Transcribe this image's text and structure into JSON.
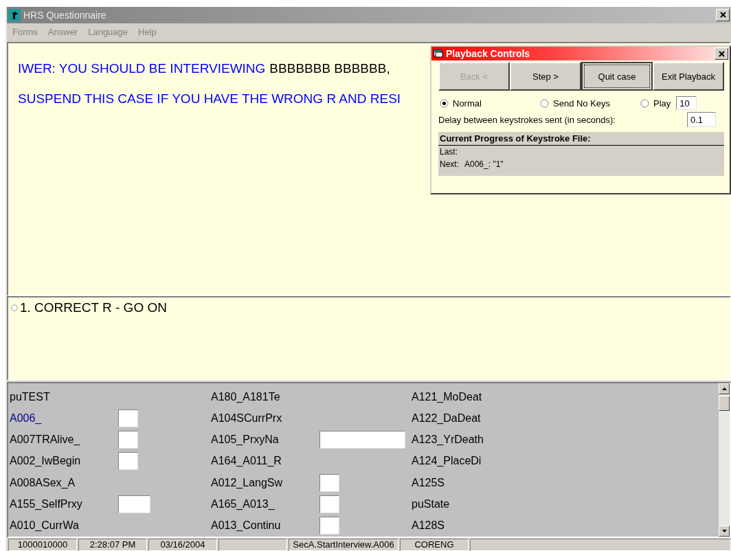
{
  "window": {
    "title": "HRS Questionnaire"
  },
  "menu": [
    "Forms",
    "Answer",
    "Language",
    "Help"
  ],
  "question": {
    "lines": [
      [
        {
          "text": "IWER: YOU SHOULD BE INTERVIEWING",
          "kind": "instruction"
        },
        {
          "text": "BBBBBBB BBBBBB,",
          "kind": "fill"
        }
      ],
      [
        {
          "text": "SUSPEND THIS CASE IF YOU HAVE THE WRONG R AND RESI",
          "kind": "instruction"
        }
      ]
    ]
  },
  "answers": [
    {
      "label": "1. CORRECT R - GO ON",
      "selected": false
    }
  ],
  "fields": [
    [
      {
        "label": "puTEST",
        "kind": "none",
        "current": false
      },
      {
        "label": "A006_",
        "kind": "small",
        "current": true
      },
      {
        "label": "A007TRAlive_",
        "kind": "small",
        "current": false
      },
      {
        "label": "A002_IwBegin",
        "kind": "small",
        "current": false
      },
      {
        "label": "A008ASex_A",
        "kind": "none",
        "current": false
      },
      {
        "label": "A155_SelfPrxy",
        "kind": "medium",
        "current": false
      },
      {
        "label": "A010_CurrWa",
        "kind": "none",
        "current": false
      }
    ],
    [
      {
        "label": "A180_A181Te",
        "kind": "none",
        "current": false
      },
      {
        "label": "A104SCurrPrx",
        "kind": "none",
        "current": false
      },
      {
        "label": "A105_PrxyNa",
        "kind": "wide",
        "current": false
      },
      {
        "label": "A164_A011_R",
        "kind": "none",
        "current": false
      },
      {
        "label": "A012_LangSw",
        "kind": "small",
        "current": false
      },
      {
        "label": "A165_A013_",
        "kind": "small",
        "current": false
      },
      {
        "label": "A013_Continu",
        "kind": "small",
        "current": false
      }
    ],
    [
      {
        "label": "A121_MoDeat",
        "kind": "none",
        "current": false
      },
      {
        "label": "A122_DaDeat",
        "kind": "none",
        "current": false
      },
      {
        "label": "A123_YrDeath",
        "kind": "none",
        "current": false
      },
      {
        "label": "A124_PlaceDi",
        "kind": "none",
        "current": false
      },
      {
        "label": "A125S",
        "kind": "none",
        "current": false
      },
      {
        "label": "puState",
        "kind": "none",
        "current": false
      },
      {
        "label": "A128S",
        "kind": "none",
        "current": false
      }
    ]
  ],
  "status_bar": [
    {
      "kind": "text",
      "text": "1000010000"
    },
    {
      "kind": "text",
      "text": "2:28:07 PM"
    },
    {
      "kind": "text",
      "text": "03/16/2004"
    },
    {
      "kind": "blank"
    },
    {
      "kind": "text",
      "text": "SecA.StartInterview.A006"
    },
    {
      "kind": "text",
      "text": "CORENG"
    },
    {
      "kind": "blank"
    }
  ],
  "playback": {
    "title": "Playback Controls",
    "buttons": [
      {
        "label": "Back <",
        "disabled": true,
        "focused": false
      },
      {
        "label": "Step >",
        "disabled": false,
        "focused": false
      },
      {
        "label": "Quit case",
        "disabled": false,
        "focused": true
      },
      {
        "label": "Exit Playback",
        "disabled": false,
        "focused": false
      }
    ],
    "modes": [
      {
        "label": "Normal",
        "selected": true
      },
      {
        "label": "Send No Keys",
        "selected": false
      },
      {
        "label": "Play",
        "selected": false
      }
    ],
    "play_count": "10",
    "delay_label": "Delay between keystrokes sent (in seconds):",
    "delay": "0.1",
    "progress": {
      "heading": "Current Progress of Keystroke File:",
      "last_label": "Last:",
      "next_label": "Next:",
      "next_value": "A006_: \"1\""
    }
  }
}
